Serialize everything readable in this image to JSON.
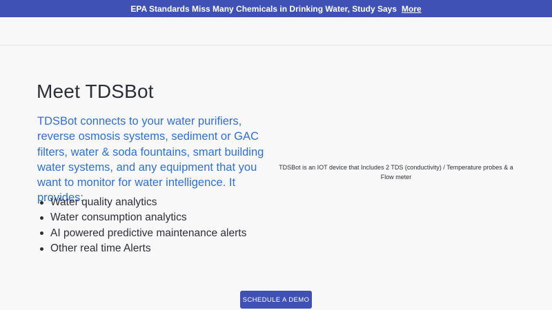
{
  "announcement": {
    "text": "EPA Standards Miss Many Chemicals in Drinking Water, Study Says",
    "link_label": "More"
  },
  "hero": {
    "title": "Meet TDSBot",
    "lead": "TDSBot connects to your water purifiers, reverse osmosis systems, sediment or GAC filters, water & soda fountains, smart building water systems, and any equipment that you want to monitor for water intelligence. It provides:",
    "features": [
      "Water quality analytics",
      "Water consumption analytics",
      "AI powered predictive maintenance alerts",
      "Other real time Alerts"
    ],
    "image_caption": "TDSBot is an IOT device that Includes 2 TDS (conductivity) / Temperature probes & a Flow meter",
    "cta_label": "SCHEDULE A DEMO"
  },
  "colors": {
    "accent": "#3f51b5",
    "lead_text": "#2f6fd6",
    "background": "#f8f8f9"
  }
}
